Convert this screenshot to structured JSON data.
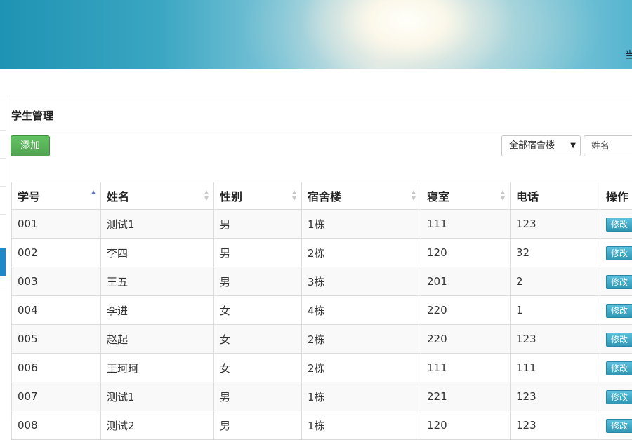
{
  "header": {
    "user_text": "当"
  },
  "panel": {
    "title": "学生管理"
  },
  "toolbar": {
    "add_label": "添加",
    "building_select": "全部宿舍楼",
    "name_placeholder": "姓名"
  },
  "table": {
    "columns": [
      "学号",
      "姓名",
      "性别",
      "宿舍楼",
      "寝室",
      "电话",
      "操作"
    ],
    "edit_label": "修改",
    "rows": [
      [
        "001",
        "测试1",
        "男",
        "1栋",
        "111",
        "123"
      ],
      [
        "002",
        "李四",
        "男",
        "2栋",
        "120",
        "32"
      ],
      [
        "003",
        "王五",
        "男",
        "3栋",
        "201",
        "2"
      ],
      [
        "004",
        "李进",
        "女",
        "4栋",
        "220",
        "1"
      ],
      [
        "005",
        "赵起",
        "女",
        "2栋",
        "220",
        "123"
      ],
      [
        "006",
        "王珂珂",
        "女",
        "2栋",
        "111",
        "111"
      ],
      [
        "007",
        "测试1",
        "男",
        "1栋",
        "221",
        "123"
      ],
      [
        "008",
        "测试2",
        "男",
        "1栋",
        "120",
        "123"
      ]
    ]
  }
}
